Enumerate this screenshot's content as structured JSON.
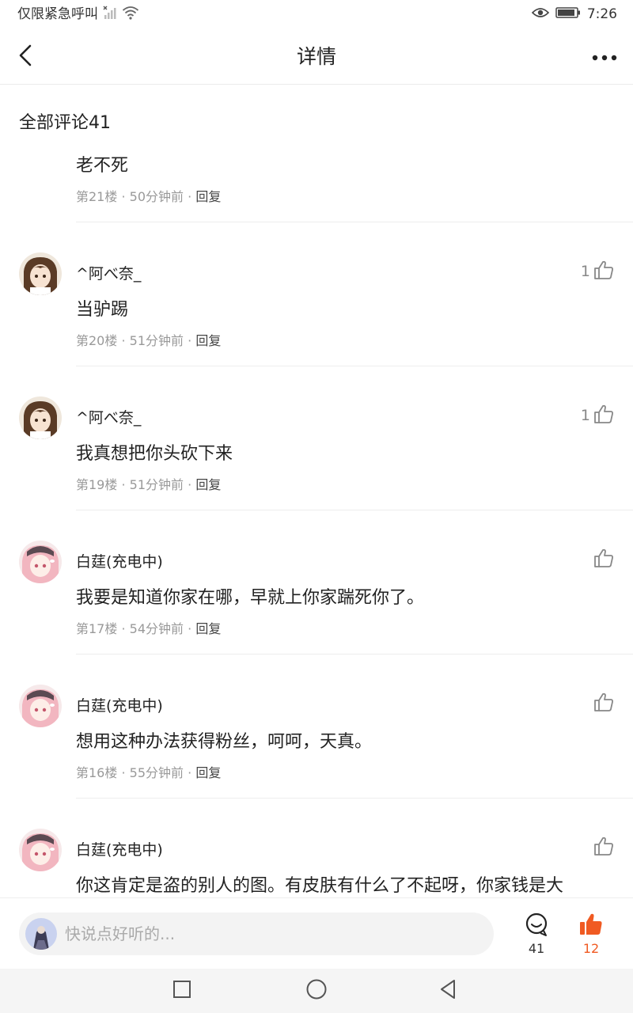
{
  "status_bar": {
    "carrier_text": "仅限紧急呼叫",
    "time": "7:26",
    "icons": [
      "signal-icon",
      "wifi-icon",
      "eye-icon",
      "battery-icon"
    ]
  },
  "header": {
    "title": "详情",
    "back_icon": "back-arrow-icon",
    "more_icon": "more-dots-icon"
  },
  "section": {
    "title": "全部评论41"
  },
  "comments": [
    {
      "username": "",
      "text": "老不死",
      "floor": "第21楼",
      "time": "50分钟前",
      "reply": "回复",
      "likes": ""
    },
    {
      "username": "^阿べ奈_",
      "text": "当驴踢",
      "floor": "第20楼",
      "time": "51分钟前",
      "reply": "回复",
      "likes": "1"
    },
    {
      "username": "^阿べ奈_",
      "text": "我真想把你头砍下来",
      "floor": "第19楼",
      "time": "51分钟前",
      "reply": "回复",
      "likes": "1"
    },
    {
      "username": "白莛(充电中)",
      "text": "我要是知道你家在哪，早就上你家踹死你了。",
      "floor": "第17楼",
      "time": "54分钟前",
      "reply": "回复",
      "likes": ""
    },
    {
      "username": "白莛(充电中)",
      "text": "想用这种办法获得粉丝，呵呵，天真。",
      "floor": "第16楼",
      "time": "55分钟前",
      "reply": "回复",
      "likes": ""
    },
    {
      "username": "白莛(充电中)",
      "text": "你这肯定是盗的别人的图。有皮肤有什么了不起呀，你家钱是大",
      "floor": "",
      "time": "",
      "reply": "",
      "likes": ""
    }
  ],
  "separator": "·",
  "bottom_bar": {
    "placeholder": "快说点好听的...",
    "comment_count": "41",
    "like_count": "12",
    "like_color": "#f05a22"
  },
  "nav_bar": {
    "icons": [
      "recent-apps-icon",
      "home-icon",
      "back-triangle-icon"
    ]
  }
}
